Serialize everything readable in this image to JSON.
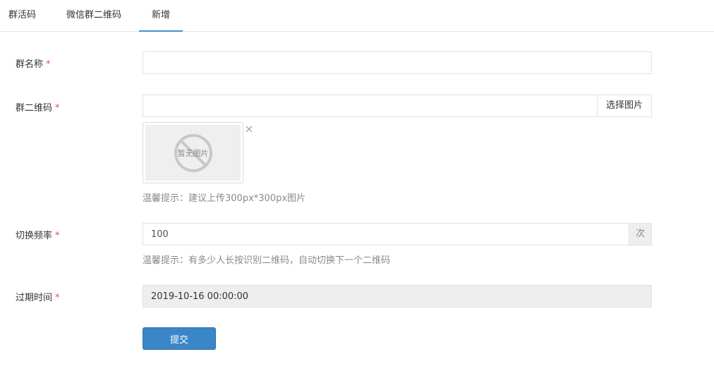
{
  "tabs": [
    {
      "label": "群活码"
    },
    {
      "label": "微信群二维码"
    },
    {
      "label": "新增",
      "active": true
    }
  ],
  "form": {
    "group_name": {
      "label": "群名称",
      "required_mark": "*",
      "value": ""
    },
    "group_qrcode": {
      "label": "群二维码",
      "required_mark": "*",
      "value": "",
      "choose_button": "选择图片",
      "placeholder_image_text": "暂无图片",
      "hint": "温馨提示：建议上传300px*300px图片"
    },
    "switch_frequency": {
      "label": "切换频率",
      "required_mark": "*",
      "value": "100",
      "unit": "次",
      "hint": "温馨提示：有多少人长按识别二维码，自动切换下一个二维码"
    },
    "expire_time": {
      "label": "过期时间",
      "required_mark": "*",
      "value": "2019-10-16 00:00:00"
    },
    "submit_label": "提交"
  },
  "colors": {
    "accent": "#3b86c8",
    "required": "#e24e4e",
    "hint": "#8a8a8a",
    "disabled_bg": "#eeeeee"
  },
  "icons": {
    "no_image": "no-image-icon",
    "remove": "close-icon"
  }
}
